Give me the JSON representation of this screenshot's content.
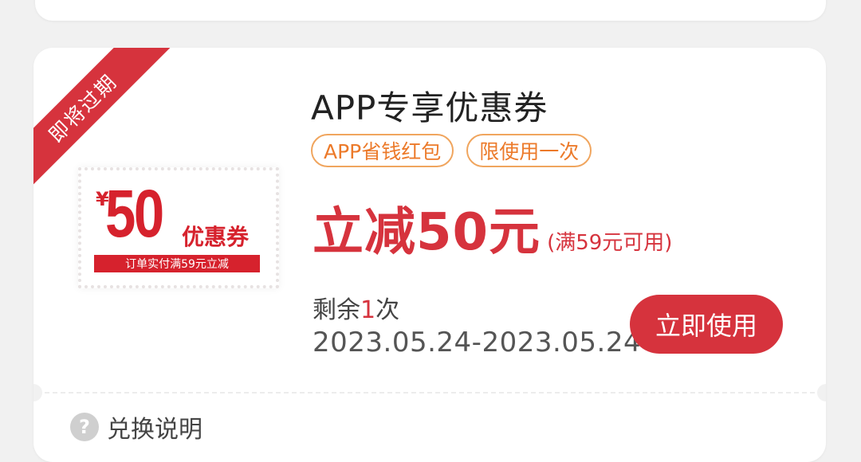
{
  "ribbon": {
    "label": "即将过期"
  },
  "stamp": {
    "currency": "¥",
    "amount": "50",
    "label": "优惠券",
    "condition": "订单实付满59元立减"
  },
  "coupon": {
    "title": "APP专享优惠券",
    "tags": [
      "APP省钱红包",
      "限使用一次"
    ],
    "discount_main": "立减50元",
    "discount_condition": "(满59元可用)",
    "remaining_prefix": "剩余",
    "remaining_count": "1",
    "remaining_suffix": "次",
    "date_range": "2023.05.24-2023.05.24",
    "use_button": "立即使用"
  },
  "footer": {
    "help_icon": "question-icon",
    "help_glyph": "?",
    "help_label": "兑换说明"
  },
  "colors": {
    "accent": "#d6333d",
    "tag_border": "#f0a55e",
    "tag_text": "#ec7a2a",
    "background": "#f1f1f1"
  }
}
